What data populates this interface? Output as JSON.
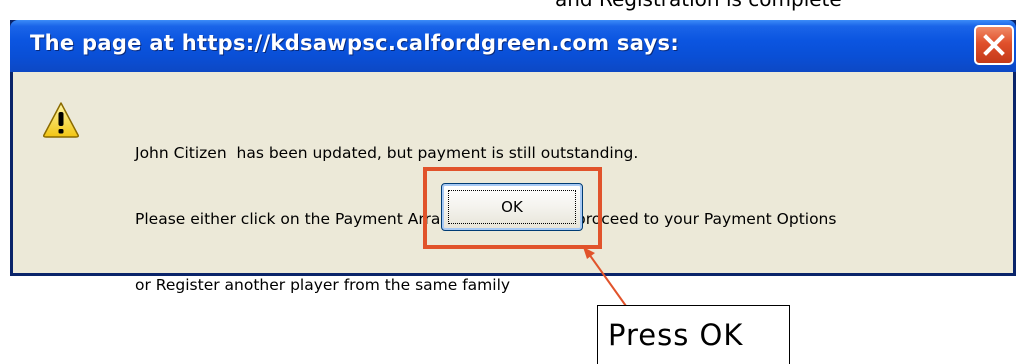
{
  "page": {
    "cutoff_text": "and Registration is complete"
  },
  "dialog": {
    "title": "The page at https://kdsawpsc.calfordgreen.com says:",
    "icon": "warning-icon",
    "message_lines": [
      "John Citizen  has been updated, but payment is still outstanding.",
      "Please either click on the Payment Arrangements link to proceed to your Payment Options",
      "or Register another player from the same family"
    ],
    "ok_label": "OK",
    "close_icon": "close-icon"
  },
  "annotation": {
    "callout_text": "Press OK",
    "highlight_color": "#e1532b"
  }
}
